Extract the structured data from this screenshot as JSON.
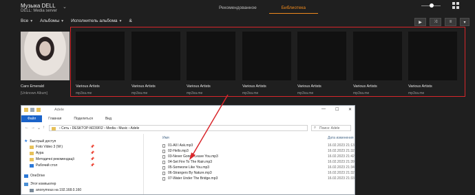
{
  "app": {
    "title": "Музыка DELL",
    "subtitle": "DELL: Media server"
  },
  "tabs": [
    {
      "label": "Рекомендованное"
    },
    {
      "label": "Библиотека"
    }
  ],
  "filters": {
    "scope": "Все",
    "view": "Альбомы",
    "sort": "Исполнитель альбома",
    "letter": "&"
  },
  "albums": [
    {
      "title": "Caro Emerald",
      "subtitle": "[Unknown Album]"
    },
    {
      "title": "Various Artists",
      "subtitle": "mp3xa.me"
    },
    {
      "title": "Various Artists",
      "subtitle": "mp3xa.me"
    },
    {
      "title": "Various Artists",
      "subtitle": "mp3xa.me"
    },
    {
      "title": "Various Artists",
      "subtitle": "mp3xa.me"
    },
    {
      "title": "Various Artists",
      "subtitle": "mp3xa.me"
    },
    {
      "title": "Various Artists",
      "subtitle": "mp3xa.me"
    },
    {
      "title": "Various Artists",
      "subtitle": "mp3xa.me"
    }
  ],
  "explorer": {
    "title": "Adele",
    "ribbon": [
      "Файл",
      "Главная",
      "Поделиться",
      "Вид"
    ],
    "address": "› Сеть › DESKTOP-M239FI2 › Media › Music › Adele",
    "search_placeholder": "Поиск: Adele",
    "nav": [
      "Быстрый доступ",
      "Foto Video 3 (W:)",
      "Аура",
      "Методичні рекомендації",
      "Рабочий стол",
      "OneDrive",
      "Этот компьютер",
      "anonymous на 192.168.0.160"
    ],
    "columns": {
      "name": "Имя",
      "date": "Дата изменения"
    },
    "files": [
      {
        "name": "01-All I Ask.mp3",
        "date": "16.02.2023 21:13"
      },
      {
        "name": "02-Hello.mp3",
        "date": "16.02.2023 21:32"
      },
      {
        "name": "03-Never Gonna Leave You.mp3",
        "date": "16.02.2023 21:42"
      },
      {
        "name": "04-Set Fire To The Rain.mp3",
        "date": "16.02.2023 21:39"
      },
      {
        "name": "05-Someone Like You.mp3",
        "date": "16.02.2023 21:34"
      },
      {
        "name": "06-Strangers By Nature.mp3",
        "date": "16.02.2023 21:32"
      },
      {
        "name": "07-Water Under The Bridge.mp3",
        "date": "16.02.2023 21:33"
      }
    ]
  },
  "colors": {
    "accent": "#f08a1d",
    "highlight_box": "#d9262b",
    "ribbon_file": "#1a63c9"
  }
}
